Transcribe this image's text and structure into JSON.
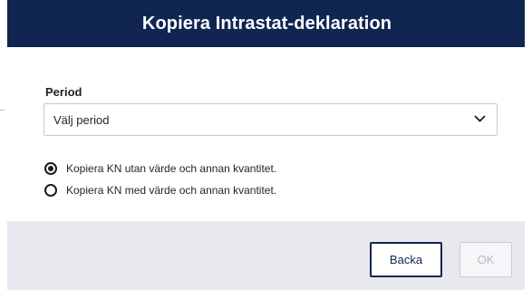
{
  "dialog": {
    "title": "Kopiera Intrastat-deklaration"
  },
  "period": {
    "label": "Period",
    "selected": "Välj period",
    "chevron_icon": "chevron-down-icon"
  },
  "copy_options": [
    {
      "label": "Kopiera KN utan värde och annan kvantitet.",
      "checked": true
    },
    {
      "label": "Kopiera KN med värde och annan kvantitet.",
      "checked": false
    }
  ],
  "footer": {
    "back_label": "Backa",
    "ok_label": "OK",
    "ok_enabled": false
  },
  "colors": {
    "header_bg": "#102552",
    "footer_bg": "#e7e9ef",
    "primary_border": "#102552",
    "disabled_text": "#b6bac2"
  }
}
